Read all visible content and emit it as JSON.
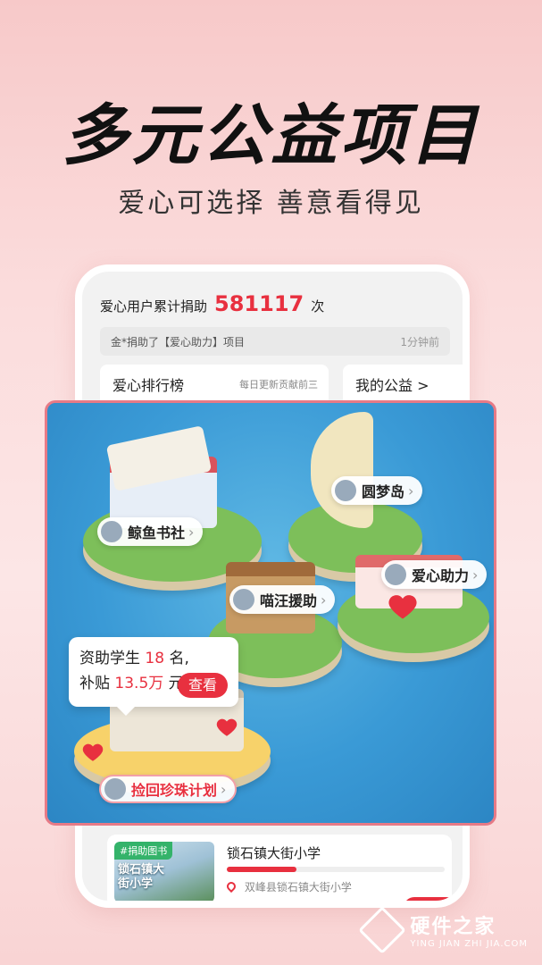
{
  "hero": {
    "title": "多元公益项目",
    "subtitle": "爱心可选择 善意看得见"
  },
  "stats": {
    "label": "爱心用户累计捐助",
    "count": "581117",
    "unit": "次"
  },
  "ticker": {
    "text": "金*捐助了【爱心助力】项目",
    "time": "1分钟前"
  },
  "cards": {
    "rank_title": "爱心排行榜",
    "rank_sub": "每日更新贡献前三",
    "mine_title": "我的公益 >"
  },
  "map": {
    "islands": [
      {
        "label": "鲸鱼书社"
      },
      {
        "label": "圆梦岛"
      },
      {
        "label": "喵汪援助"
      },
      {
        "label": "爱心助力"
      },
      {
        "label": "捡回珍珠计划"
      }
    ],
    "popup": {
      "line1_prefix": "资助学生",
      "line1_num": "18",
      "line1_suffix": "名,",
      "line2_prefix": "补贴",
      "line2_num": "13.5万",
      "line2_suffix": "元",
      "button": "查看"
    }
  },
  "project": {
    "tag": "#捐助图书",
    "thumb_text": "锁石镇大街小学",
    "name": "锁石镇大街小学",
    "address": "双峰县锁石镇大街小学",
    "progress": 0.32
  },
  "watermark": {
    "name": "硬件之家",
    "url": "YING JIAN ZHI JIA.COM"
  },
  "colors": {
    "accent": "#e8303f",
    "water": "#3a9ad6",
    "grass": "#7dbf5a"
  }
}
